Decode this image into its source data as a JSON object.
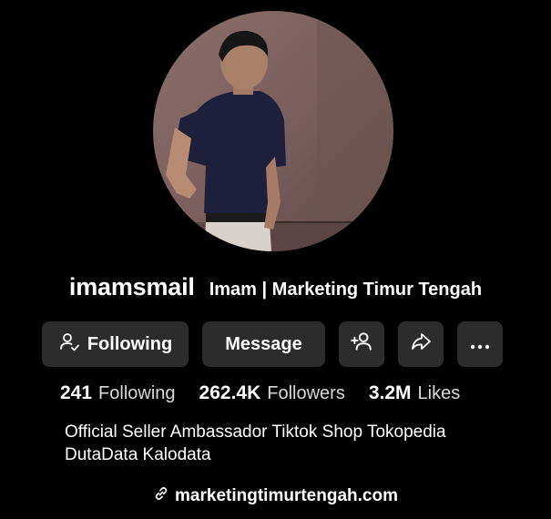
{
  "profile": {
    "username": "imamsmail",
    "nickname": "Imam | Marketing Timur Tengah",
    "avatar_icon": "profile-photo"
  },
  "actions": {
    "following_label": "Following",
    "message_label": "Message",
    "add_friend_icon": "add-user-icon",
    "share_icon": "share-icon",
    "more_icon": "more-icon"
  },
  "stats": [
    {
      "value": "241",
      "label": "Following"
    },
    {
      "value": "262.4K",
      "label": "Followers"
    },
    {
      "value": "3.2M",
      "label": "Likes"
    }
  ],
  "bio": {
    "line1": "Official Seller Ambassador Tiktok Shop Tokopedia",
    "line2": "DutaData Kalodata"
  },
  "link": {
    "text": "marketingtimurtengah.com",
    "icon": "link-icon"
  },
  "colors": {
    "background": "#000000",
    "button": "#2c2c2c",
    "text": "#ffffff",
    "muted_text": "#d8d8d8"
  }
}
